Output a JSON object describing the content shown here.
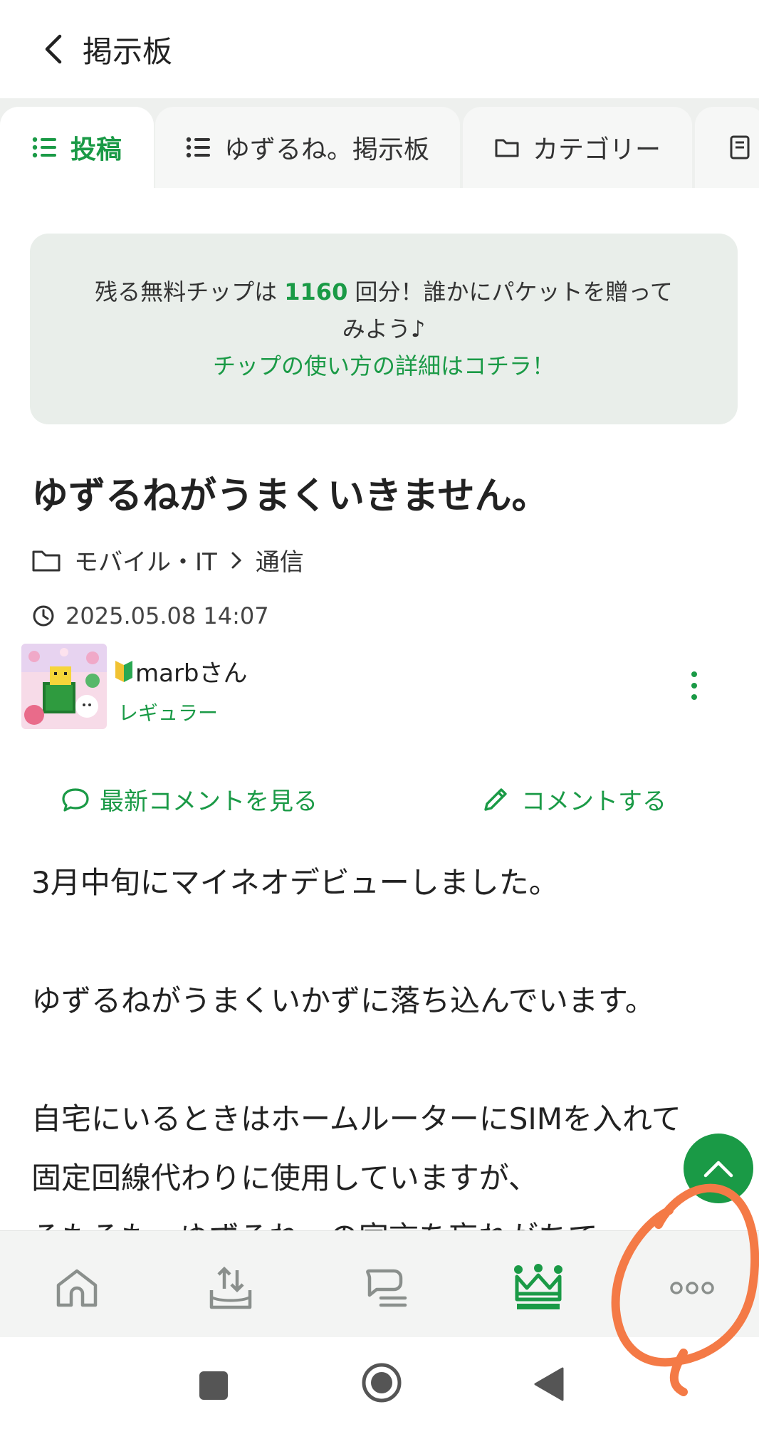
{
  "header": {
    "title": "掲示板"
  },
  "tabs": [
    {
      "label": "投稿",
      "icon": "list-icon"
    },
    {
      "label": "ゆずるね。掲示板",
      "icon": "list-icon"
    },
    {
      "label": "カテゴリー",
      "icon": "folder-icon"
    },
    {
      "label": "",
      "icon": "book-icon"
    }
  ],
  "notice": {
    "line1_prefix": "残る無料チップは ",
    "count": "1160",
    "line1_suffix": " 回分！誰かにパケットを贈って",
    "line2": "みよう♪",
    "link": "チップの使い方の詳細はコチラ！"
  },
  "post": {
    "title": "ゆずるねがうまくいきません。",
    "category": "モバイル・IT",
    "subcategory": "通信",
    "date": "2025.05.08 14:07",
    "author": "marbさん",
    "rank": "レギュラー",
    "body": "3月中旬にマイネオデビューしました。\n\nゆずるねがうまくいかずに落ち込んでいます。\n\n自宅にいるときはホームルーターにSIMを入れて\n固定回線代わりに使用していますが、\nそもそも、ゆずるね。の宣言を忘れがちで、"
  },
  "actions": {
    "latest_comments": "最新コメントを見る",
    "comment": "コメントする"
  },
  "bottom_nav": [
    {
      "icon": "home-icon"
    },
    {
      "icon": "upload-tray-icon"
    },
    {
      "icon": "chat-bubble-icon"
    },
    {
      "icon": "crown-icon",
      "active": true
    },
    {
      "icon": "more-horizontal-icon"
    }
  ],
  "colors": {
    "accent": "#1a9a46",
    "annotation": "#f47a46"
  }
}
